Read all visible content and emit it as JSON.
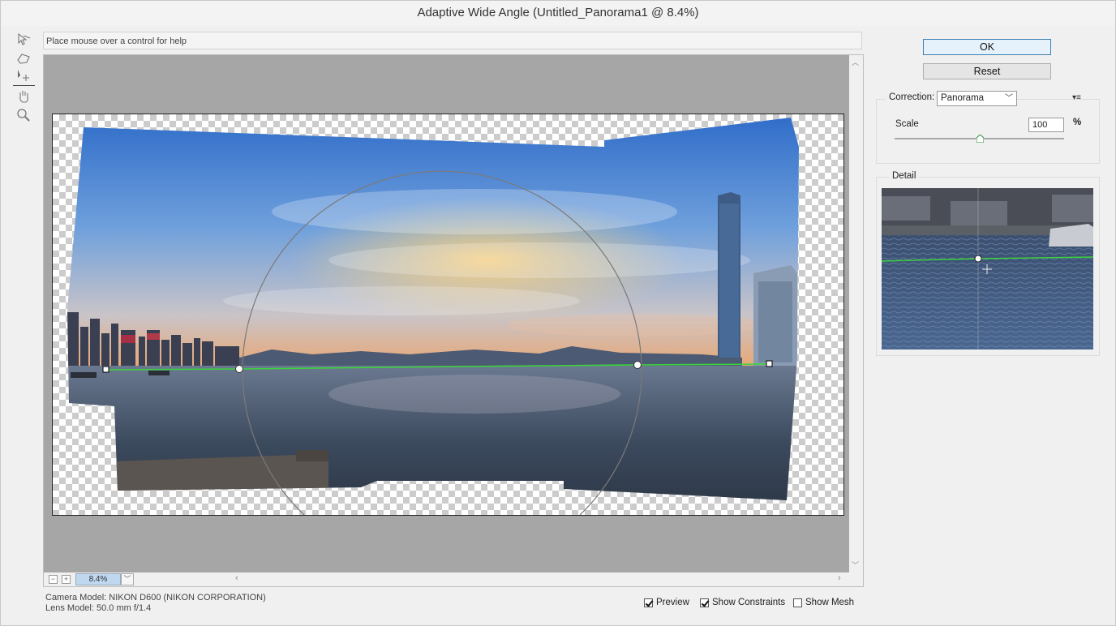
{
  "window": {
    "title": "Adaptive Wide Angle (Untitled_Panorama1 @ 8.4%)"
  },
  "tools": [
    {
      "icon": "constraint-tool-icon"
    },
    {
      "icon": "polygon-constraint-tool-icon"
    },
    {
      "icon": "move-tool-icon"
    },
    {
      "icon": "hand-tool-icon"
    },
    {
      "icon": "zoom-tool-icon"
    }
  ],
  "help": {
    "text": "Place mouse over a control for help"
  },
  "zoom": {
    "level": "8.4%",
    "minus": "−",
    "plus": "+"
  },
  "info": {
    "camera_model": "Camera Model: NIKON D600 (NIKON CORPORATION)",
    "lens_model": "Lens Model: 50.0 mm f/1.4"
  },
  "options": {
    "preview": {
      "label": "Preview",
      "checked": true
    },
    "show_constraints": {
      "label": "Show Constraints",
      "checked": true
    },
    "show_mesh": {
      "label": "Show Mesh",
      "checked": false
    }
  },
  "buttons": {
    "ok": "OK",
    "reset": "Reset"
  },
  "correction": {
    "label": "Correction:",
    "value": "Panorama"
  },
  "scale": {
    "label": "Scale",
    "value": "100",
    "unit": "%",
    "slider_fraction": 0.5
  },
  "detail": {
    "label": "Detail"
  },
  "colors": {
    "constraint": "#3bd43b",
    "sky": "#4a7fc7",
    "water": "#3b4a5e"
  }
}
